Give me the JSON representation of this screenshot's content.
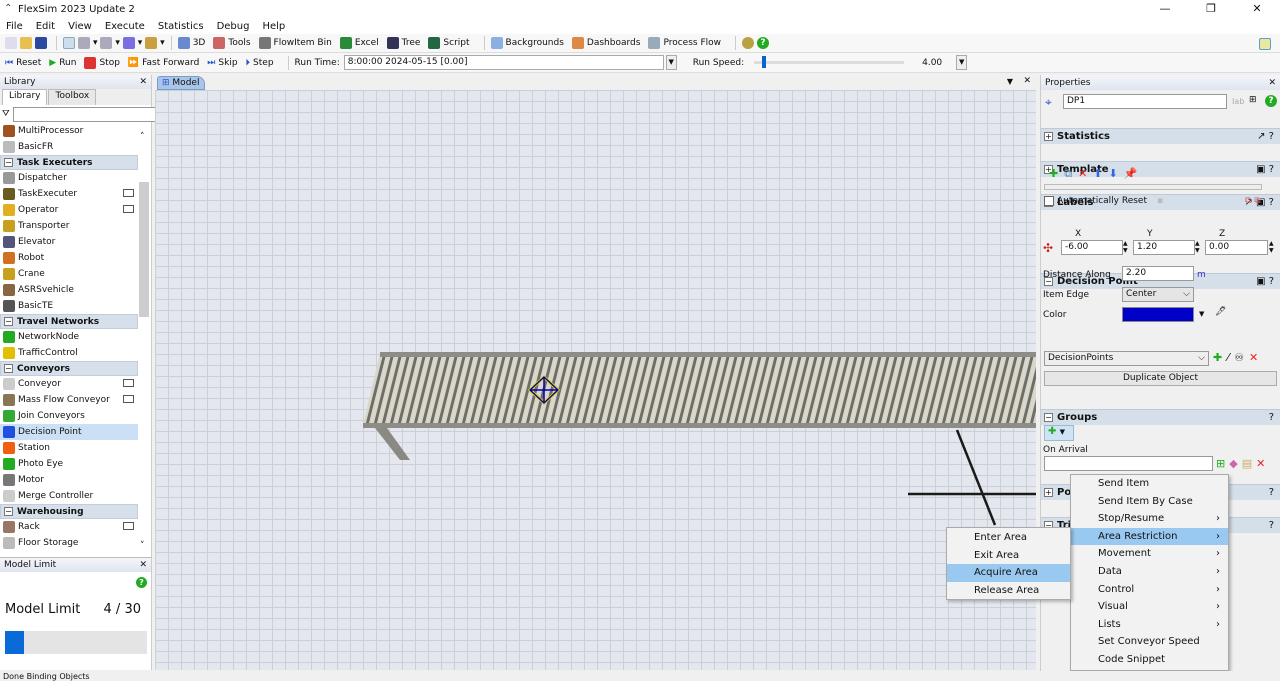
{
  "window": {
    "title": "FlexSim 2023 Update 2"
  },
  "menu": [
    "File",
    "Edit",
    "View",
    "Execute",
    "Statistics",
    "Debug",
    "Help"
  ],
  "toolbar": {
    "items": [
      "3D",
      "Tools",
      "FlowItem Bin",
      "Excel",
      "Tree",
      "Script",
      "Backgrounds",
      "Dashboards",
      "Process Flow"
    ]
  },
  "runbar": {
    "reset": "Reset",
    "run": "Run",
    "stop": "Stop",
    "fast_forward": "Fast Forward",
    "skip": "Skip",
    "step": "Step",
    "run_time_label": "Run Time:",
    "run_time": "8:00:00  2024-05-15  [0.00]",
    "run_speed_label": "Run Speed:",
    "run_speed": "4.00",
    "run_speed_fraction": 0.05
  },
  "library": {
    "title": "Library",
    "tabs": [
      "Library",
      "Toolbox"
    ],
    "filter_value": "",
    "rows": [
      {
        "t": "item",
        "label": "MultiProcessor",
        "color": "#a0521e"
      },
      {
        "t": "item",
        "label": "BasicFR",
        "color": "#bbb"
      },
      {
        "t": "cat",
        "label": "Task Executers"
      },
      {
        "t": "item",
        "label": "Dispatcher",
        "color": "#999"
      },
      {
        "t": "item",
        "label": "TaskExecuter",
        "color": "#6a5a20",
        "extra": true
      },
      {
        "t": "item",
        "label": "Operator",
        "color": "#e0b020",
        "extra": true
      },
      {
        "t": "item",
        "label": "Transporter",
        "color": "#c8a020"
      },
      {
        "t": "item",
        "label": "Elevator",
        "color": "#557"
      },
      {
        "t": "item",
        "label": "Robot",
        "color": "#d07020"
      },
      {
        "t": "item",
        "label": "Crane",
        "color": "#c8a020"
      },
      {
        "t": "item",
        "label": "ASRSvehicle",
        "color": "#864"
      },
      {
        "t": "item",
        "label": "BasicTE",
        "color": "#555"
      },
      {
        "t": "cat",
        "label": "Travel Networks"
      },
      {
        "t": "item",
        "label": "NetworkNode",
        "color": "#2a2"
      },
      {
        "t": "item",
        "label": "TrafficControl",
        "color": "#e0c000"
      },
      {
        "t": "cat",
        "label": "Conveyors"
      },
      {
        "t": "item",
        "label": "Conveyor",
        "color": "#ccc",
        "extra": true
      },
      {
        "t": "item",
        "label": "Mass Flow Conveyor",
        "color": "#875",
        "extra": true
      },
      {
        "t": "item",
        "label": "Join Conveyors",
        "color": "#3a3"
      },
      {
        "t": "item",
        "label": "Decision Point",
        "color": "#2050e0",
        "selected": true
      },
      {
        "t": "item",
        "label": "Station",
        "color": "#f06010"
      },
      {
        "t": "item",
        "label": "Photo Eye",
        "color": "#2a2"
      },
      {
        "t": "item",
        "label": "Motor",
        "color": "#777"
      },
      {
        "t": "item",
        "label": "Merge Controller",
        "color": "#ccc"
      },
      {
        "t": "cat",
        "label": "Warehousing"
      },
      {
        "t": "item",
        "label": "Rack",
        "color": "#976",
        "extra": true
      },
      {
        "t": "item",
        "label": "Floor Storage",
        "color": "#bbb"
      }
    ]
  },
  "model_limit": {
    "title": "Model Limit",
    "label": "Model Limit",
    "value": "4 / 30",
    "fraction": 0.133
  },
  "model": {
    "tab": "Model"
  },
  "properties": {
    "title": "Properties",
    "name": "DP1",
    "sections": {
      "statistics": "Statistics",
      "template": "Template",
      "labels": "Labels",
      "decision_point": "Decision Point",
      "groups": "Groups",
      "ports": "Ports",
      "triggers": "Triggers"
    },
    "auto_reset": "Automatically Reset",
    "x_label": "X",
    "y_label": "Y",
    "z_label": "Z",
    "x": "-6.00",
    "y": "1.20",
    "z": "0.00",
    "distance_label": "Distance Along",
    "distance": "2.20",
    "distance_unit": "m",
    "item_edge_label": "Item Edge",
    "item_edge": "Center",
    "color_label": "Color",
    "color": "#0000c8",
    "group": "DecisionPoints",
    "duplicate": "Duplicate Object",
    "on_arrival": "On Arrival",
    "on_arrival_value": ""
  },
  "trigger_menu": [
    {
      "label": "Send Item"
    },
    {
      "label": "Send Item By Case"
    },
    {
      "label": "Stop/Resume",
      "sub": true
    },
    {
      "label": "Area Restriction",
      "sub": true,
      "hl": true
    },
    {
      "label": "Movement",
      "sub": true
    },
    {
      "label": "Data",
      "sub": true
    },
    {
      "label": "Control",
      "sub": true
    },
    {
      "label": "Visual",
      "sub": true
    },
    {
      "label": "Lists",
      "sub": true
    },
    {
      "label": "Set Conveyor Speed"
    },
    {
      "label": "Code Snippet"
    }
  ],
  "submenu": [
    {
      "label": "Enter Area"
    },
    {
      "label": "Exit Area"
    },
    {
      "label": "Acquire Area",
      "hl": true
    },
    {
      "label": "Release Area"
    }
  ],
  "status": "Done Binding Objects"
}
